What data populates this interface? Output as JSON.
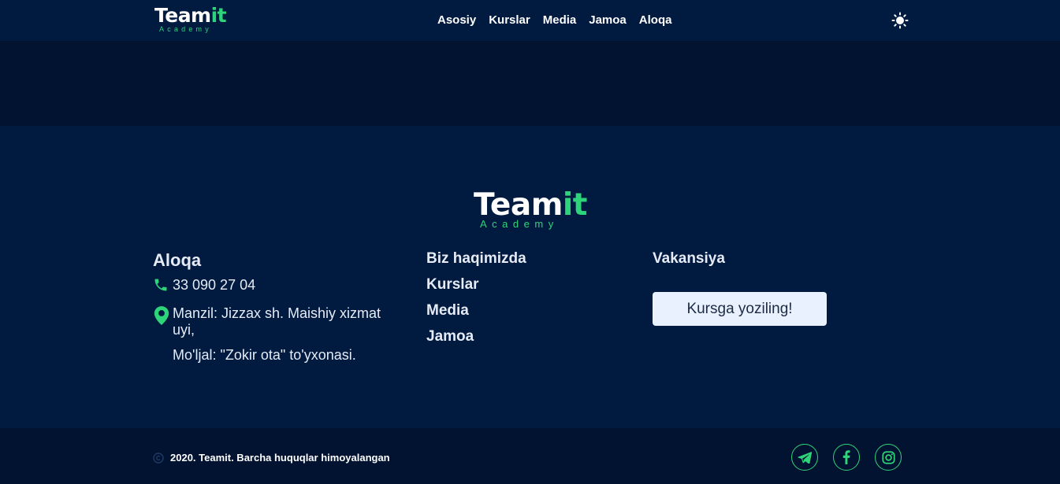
{
  "brand": {
    "name_main": "Team",
    "name_accent": "it",
    "subtitle": "Academy"
  },
  "nav": {
    "links": [
      "Asosiy",
      "Kurslar",
      "Media",
      "Jamoa",
      "Aloqa"
    ]
  },
  "icons": {
    "theme_toggle": "sun-icon",
    "phone": "phone-icon",
    "location": "map-pin-icon",
    "copyright": "copyright-icon",
    "socials": [
      "telegram-icon",
      "facebook-icon",
      "instagram-icon"
    ]
  },
  "colors": {
    "background": "#001a40",
    "band": "#011330",
    "accent": "#2ed47a",
    "button_bg": "#e8f1fd"
  },
  "contact": {
    "heading": "Aloqa",
    "phone": "33 090 27 04",
    "address": "Manzil: Jizzax sh. Maishiy xizmat uyi,",
    "landmark": "Mo'ljal: \"Zokir ota\" to'yxonasi."
  },
  "footer_links": [
    "Biz haqimizda",
    "Kurslar",
    "Media",
    "Jamoa"
  ],
  "vacancy": {
    "label": "Vakansiya",
    "button_label": "Kursga yoziling!"
  },
  "bottom": {
    "copyright": "2020. Teamit. Barcha huquqlar himoyalangan"
  }
}
